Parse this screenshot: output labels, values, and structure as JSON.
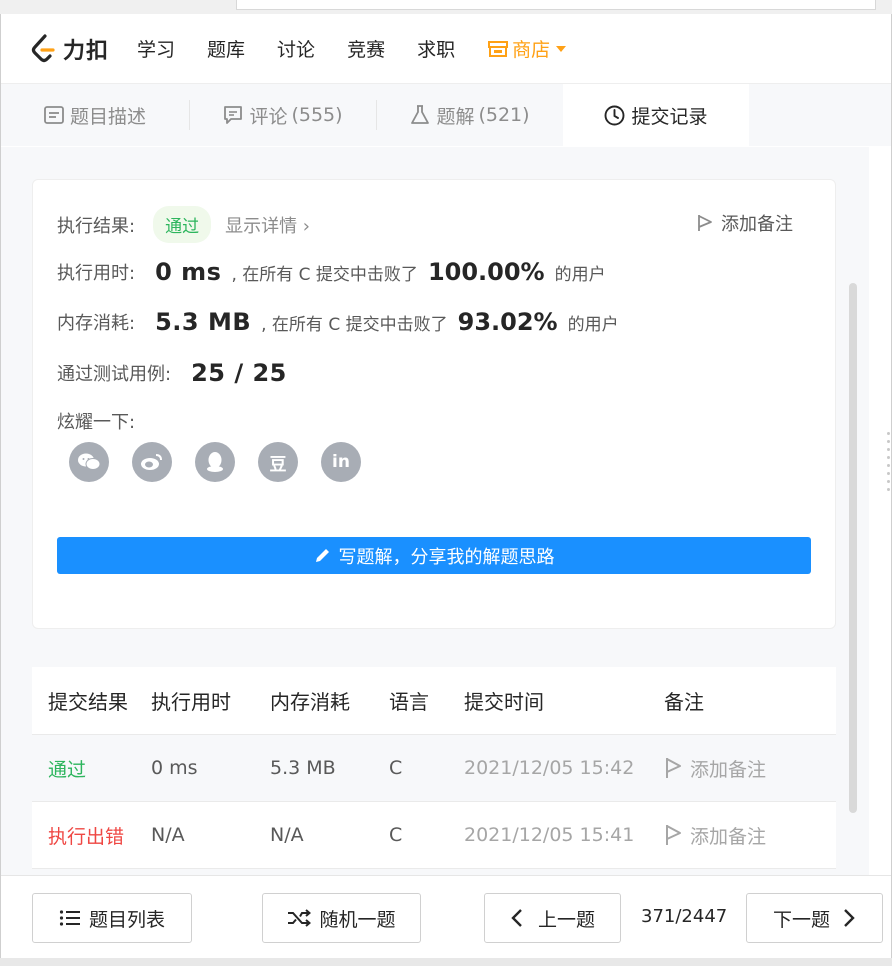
{
  "nav": {
    "logo_text": "力扣",
    "items": [
      "学习",
      "题库",
      "讨论",
      "竞赛",
      "求职"
    ],
    "shop_label": "商店",
    "accent": "#ffa116"
  },
  "tabs": [
    {
      "label": "题目描述",
      "count": "",
      "icon": "description-icon"
    },
    {
      "label": "评论",
      "count": "(555)",
      "icon": "comment-icon"
    },
    {
      "label": "题解",
      "count": "(521)",
      "icon": "flask-icon"
    },
    {
      "label": "提交记录",
      "count": "",
      "icon": "clock-icon"
    }
  ],
  "result": {
    "status_label": "执行结果:",
    "status": "通过",
    "detail_link": "显示详情 ›",
    "add_note": "添加备注",
    "runtime_label": "执行用时:",
    "runtime_value": "0 ms",
    "runtime_text": ", 在所有 C 提交中击败了",
    "runtime_pct": "100.00%",
    "runtime_suffix": "的用户",
    "memory_label": "内存消耗:",
    "memory_value": "5.3 MB",
    "memory_text": ", 在所有 C 提交中击败了",
    "memory_pct": "93.02%",
    "memory_suffix": "的用户",
    "tests_label": "通过测试用例:",
    "tests_value": "25 / 25",
    "share_label": "炫耀一下:",
    "share_icons": [
      "wechat-icon",
      "weibo-icon",
      "qq-icon",
      "douban-icon",
      "linkedin-icon"
    ],
    "douban_glyph": "豆",
    "linkedin_glyph": "in",
    "write_button": "写题解，分享我的解题思路"
  },
  "table": {
    "headers": [
      "提交结果",
      "执行用时",
      "内存消耗",
      "语言",
      "提交时间",
      "备注"
    ],
    "rows": [
      {
        "result": "通过",
        "runtime": "0 ms",
        "memory": "5.3 MB",
        "lang": "C",
        "time": "2021/12/05 15:42",
        "note": "添加备注"
      },
      {
        "result": "执行出错",
        "runtime": "N/A",
        "memory": "N/A",
        "lang": "C",
        "time": "2021/12/05 15:41",
        "note": "添加备注"
      }
    ]
  },
  "footer": {
    "list_button": "题目列表",
    "random_button": "随机一题",
    "prev_button": "上一题",
    "pager": "371/2447",
    "next_button": "下一题"
  },
  "colors": {
    "pass": "#2db55d",
    "error": "#ef4743",
    "primary": "#1a90ff"
  }
}
